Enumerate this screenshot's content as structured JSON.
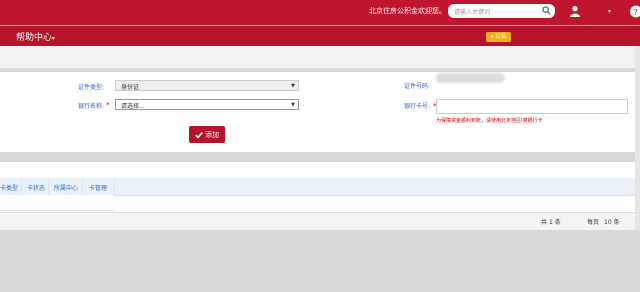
{
  "header": {
    "welcome": "北京住房公积金欢迎您。",
    "search_placeholder": "请输入关键词",
    "caret": "▾"
  },
  "nav": {
    "title": "帮助中心",
    "caret": "▾",
    "badge": "公告"
  },
  "form": {
    "id_type_label": "证件类型:",
    "id_type_value": "身份证",
    "id_number_label": "证件号码:",
    "bank_label": "银行名称:",
    "bank_value": "请选择...",
    "card_label": "银行卡号:",
    "required_mark": "*",
    "hint": "为保障资金顺利到账，请使用北京地区Ⅰ类银行卡",
    "add_button": "添加",
    "select_arrow": "▼"
  },
  "table": {
    "columns": [
      "卡类型",
      "卡状态",
      "所属中心",
      "卡管理"
    ]
  },
  "pagination": {
    "total_prefix": "共",
    "total_count": "1",
    "total_suffix": "条",
    "page_size_prefix": "每页",
    "page_size": "10",
    "page_size_suffix": "条"
  },
  "colors": {
    "brand_red": "#c0152f",
    "badge_orange": "#f0ad1e",
    "link_blue": "#3366cc"
  }
}
